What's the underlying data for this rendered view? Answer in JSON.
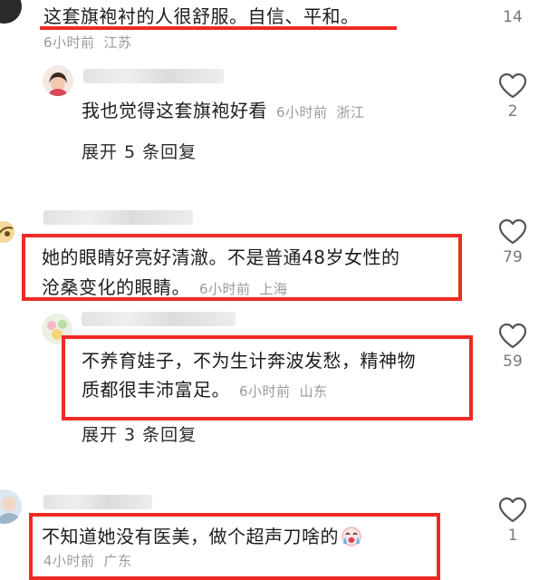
{
  "comments": [
    {
      "text": "这套旗袍衬的人很舒服。自信、平和。",
      "time": "6小时前",
      "location": "江苏",
      "likes": "14",
      "replies": [
        {
          "text": "我也觉得这套旗袍好看",
          "time": "6小时前",
          "location": "浙江",
          "likes": "2"
        }
      ],
      "expand_label": "展开 5 条回复"
    },
    {
      "text_line1": "她的眼睛好亮好清澈。不是普通48岁女性的",
      "text_line2": "沧桑变化的眼睛。",
      "time": "6小时前",
      "location": "上海",
      "likes": "79",
      "replies": [
        {
          "text_line1": "不养育娃子，不为生计奔波发愁，精神物",
          "text_line2": "质都很丰沛富足。",
          "time": "6小时前",
          "location": "山东",
          "likes": "59"
        }
      ],
      "expand_label": "展开 3 条回复"
    },
    {
      "text": "不知道她没有医美，做个超声刀啥的",
      "emoji": "crying-face-emoji",
      "time": "4小时前",
      "location": "广东",
      "likes": "1"
    }
  ],
  "colors": {
    "highlight": "#ee2a24",
    "meta": "#9a9a9a"
  }
}
